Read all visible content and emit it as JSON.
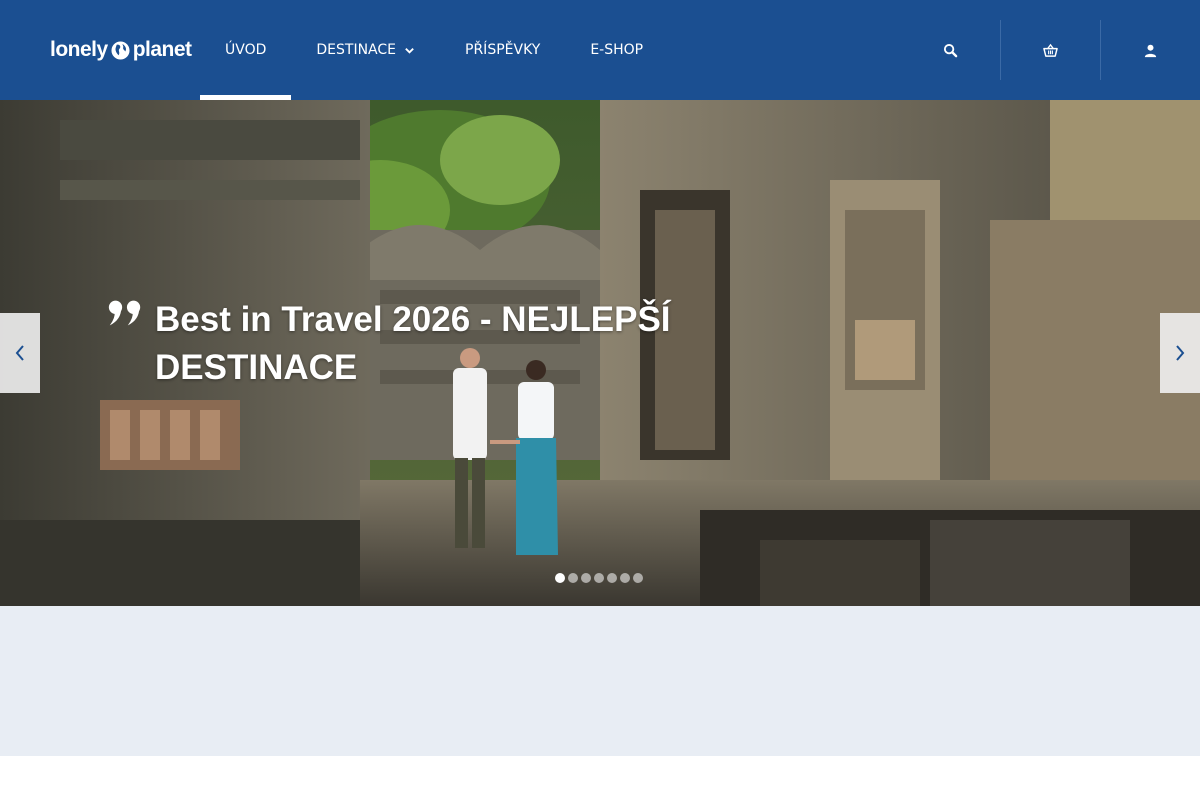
{
  "header": {
    "logo_left": "lonely",
    "logo_right": "planet",
    "nav": [
      {
        "label": "ÚVOD",
        "active": true
      },
      {
        "label": "DESTINACE",
        "has_dropdown": true
      },
      {
        "label": "PŘÍSPĚVKY"
      },
      {
        "label": "E-SHOP"
      }
    ],
    "icons": [
      "search-icon",
      "basket-icon",
      "user-icon"
    ]
  },
  "hero": {
    "title": "Best in Travel 2026 - NEJLEPŠÍ DESTINACE",
    "slides_count": 7,
    "active_slide": 1
  },
  "colors": {
    "header_bg": "#1b4f91",
    "band_bg": "#e8edf4",
    "text_light": "#ffffff"
  }
}
